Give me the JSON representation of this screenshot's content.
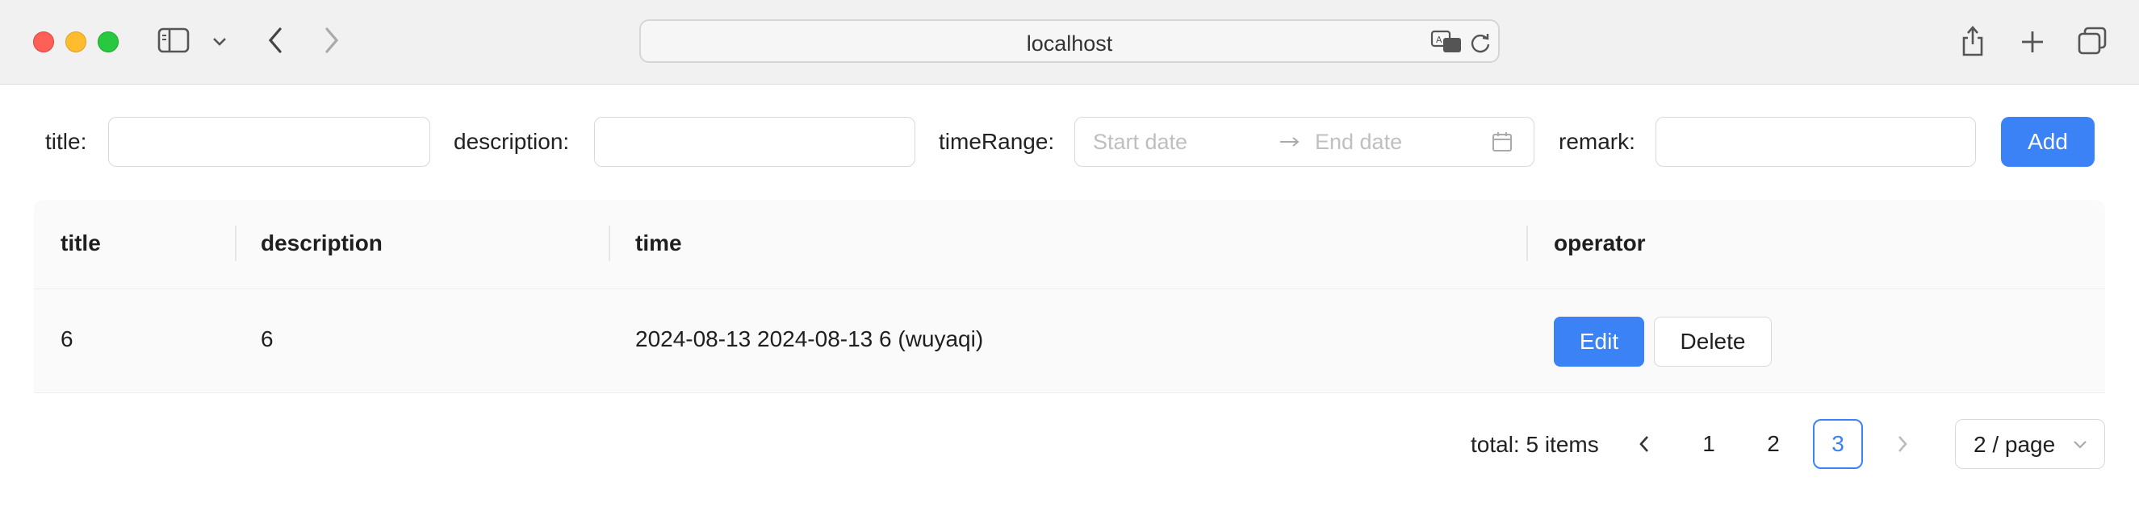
{
  "browser": {
    "url": "localhost",
    "icons": [
      "sidebar-icon",
      "chevron-down-icon",
      "back-icon",
      "forward-icon",
      "translate-icon",
      "reload-icon",
      "share-icon",
      "plus-icon",
      "tabs-icon"
    ]
  },
  "filters": {
    "title_label": "title:",
    "description_label": "description:",
    "time_range_label": "timeRange:",
    "start_placeholder": "Start date",
    "end_placeholder": "End date",
    "remark_label": "remark:",
    "add_label": "Add"
  },
  "table": {
    "headers": [
      "title",
      "description",
      "time",
      "operator"
    ],
    "rows": [
      {
        "title": "6",
        "description": "6",
        "time": "2024-08-13 2024-08-13 6 (wuyaqi)",
        "edit_label": "Edit",
        "delete_label": "Delete"
      }
    ]
  },
  "pagination": {
    "total_text": "total: 5 items",
    "pages": [
      "1",
      "2",
      "3"
    ],
    "current_page": "3",
    "page_size": "2 / page"
  },
  "colors": {
    "primary": "#3b82f6",
    "header_bg": "#fafafa",
    "border": "#d9d9d9"
  }
}
